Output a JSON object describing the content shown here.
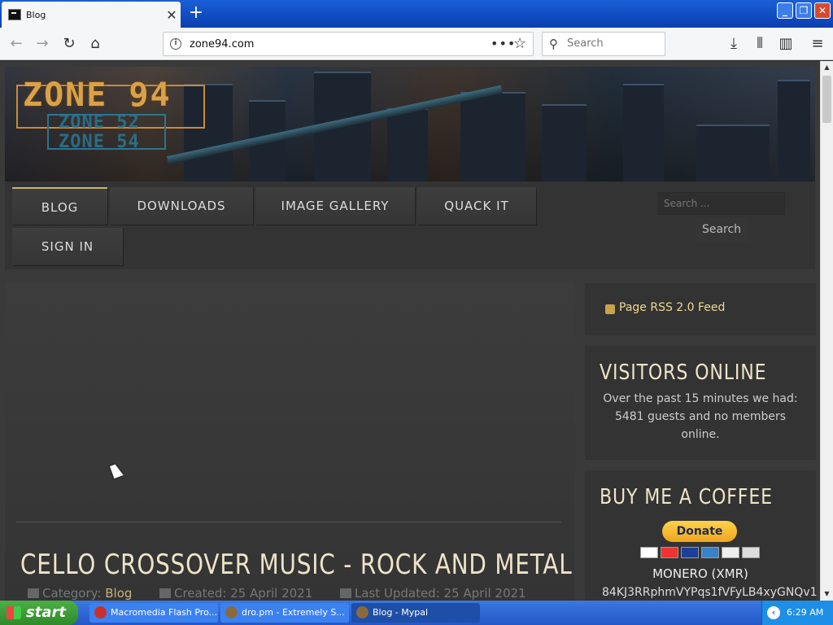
{
  "browser": {
    "tab_title": "Blog",
    "url": "zone94.com",
    "search_placeholder": "Search"
  },
  "site": {
    "logo_main": "ZONE 94",
    "logo_sub1": "ZONE 52",
    "logo_sub2": "ZONE 54",
    "menu": [
      {
        "label": "BLOG"
      },
      {
        "label": "DOWNLOADS"
      },
      {
        "label": "IMAGE GALLERY"
      },
      {
        "label": "QUACK IT"
      },
      {
        "label": "SIGN IN"
      }
    ],
    "search_placeholder": "Search ...",
    "search_button": "Search"
  },
  "article": {
    "title": "CELLO CROSSOVER MUSIC - ROCK AND METAL",
    "category_label": "Category:",
    "category": "Blog",
    "created": "Created: 25 April 2021",
    "updated": "Last Updated: 25 April 2021"
  },
  "sidebar": {
    "rss": "Page RSS 2.0 Feed",
    "visitors_heading": "VISITORS ONLINE",
    "visitors_text": "Over the past 15 minutes we had: 5481 guests and no members online.",
    "coffee_heading": "BUY ME A COFFEE",
    "donate": "Donate",
    "monero_label": "MONERO (XMR)",
    "monero_address": "84KJ3RRphmVYPqs1fVFyLB4xyGNQv1"
  },
  "taskbar": {
    "start": "start",
    "tasks": [
      {
        "label": "Macromedia Flash Pro..."
      },
      {
        "label": "dro.pm - Extremely S..."
      },
      {
        "label": "Blog - Mypal"
      }
    ],
    "clock": "6:29 AM"
  }
}
